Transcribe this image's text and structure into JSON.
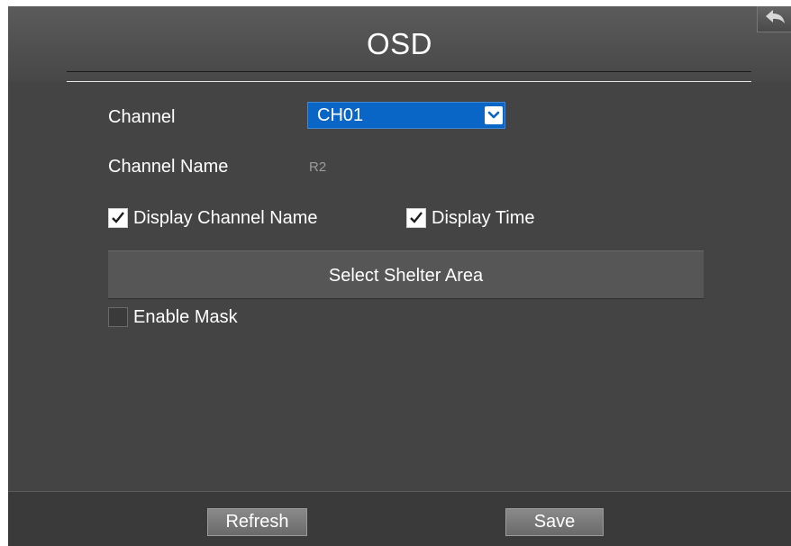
{
  "window": {
    "title": "OSD"
  },
  "form": {
    "channel_label": "Channel",
    "channel_value": "CH01",
    "channel_name_label": "Channel Name",
    "channel_name_value": "R2",
    "display_channel_name": {
      "label": "Display Channel Name",
      "checked": true
    },
    "display_time": {
      "label": "Display Time",
      "checked": true
    },
    "select_shelter_area_label": "Select Shelter Area",
    "enable_mask": {
      "label": "Enable Mask",
      "checked": false
    }
  },
  "footer": {
    "refresh_label": "Refresh",
    "save_label": "Save"
  },
  "colors": {
    "accent": "#0a66c6",
    "panel": "#444444"
  },
  "icons": {
    "back": "back-arrow-icon",
    "dropdown": "chevron-down-icon",
    "check": "checkmark-icon"
  }
}
